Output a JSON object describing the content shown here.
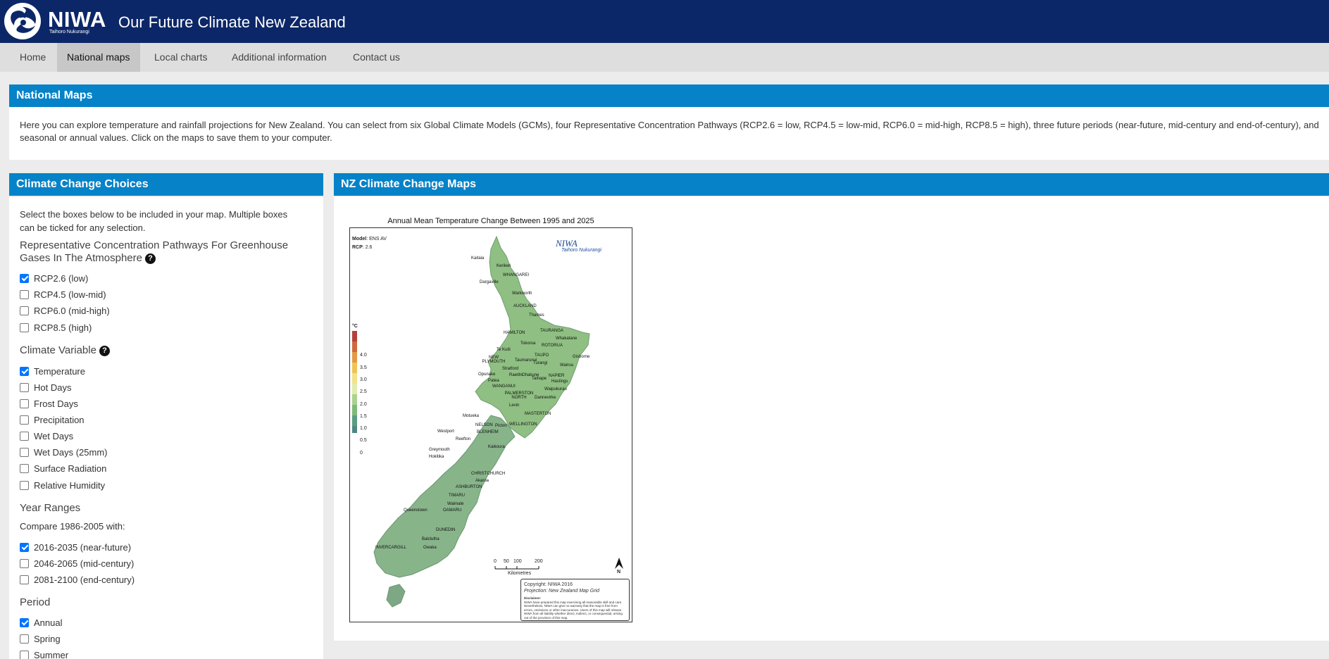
{
  "header": {
    "logo_text": "NIWA",
    "logo_subtext": "Taihoro Nukurangi",
    "site_title": "Our Future Climate New Zealand"
  },
  "nav": {
    "items": [
      "Home",
      "National maps",
      "Local charts",
      "Additional information",
      "Contact us"
    ],
    "active": "National maps"
  },
  "intro": {
    "heading": "National Maps",
    "text": "Here you can explore temperature and rainfall projections for New Zealand. You can select from six Global Climate Models (GCMs), four Representative Concentration Pathways (RCP2.6 = low, RCP4.5 = low-mid, RCP6.0 = mid-high, RCP8.5 = high), three future periods (near-future, mid-century and end-of-century), and seasonal or annual values. Click on the maps to save them to your computer."
  },
  "choices": {
    "heading": "Climate Change Choices",
    "intro": "Select the boxes below to be included in your map. Multiple boxes can be ticked for any selection.",
    "help_glyph": "?",
    "rcp": {
      "title": "Representative Concentration Pathways For Greenhouse Gases In The Atmosphere",
      "options": [
        {
          "label": "RCP2.6 (low)",
          "checked": true
        },
        {
          "label": "RCP4.5 (low-mid)",
          "checked": false
        },
        {
          "label": "RCP6.0 (mid-high)",
          "checked": false
        },
        {
          "label": "RCP8.5 (high)",
          "checked": false
        }
      ]
    },
    "variable": {
      "title": "Climate Variable",
      "options": [
        {
          "label": "Temperature",
          "checked": true
        },
        {
          "label": "Hot Days",
          "checked": false
        },
        {
          "label": "Frost Days",
          "checked": false
        },
        {
          "label": "Precipitation",
          "checked": false
        },
        {
          "label": "Wet Days",
          "checked": false
        },
        {
          "label": "Wet Days (25mm)",
          "checked": false
        },
        {
          "label": "Surface Radiation",
          "checked": false
        },
        {
          "label": "Relative Humidity",
          "checked": false
        }
      ]
    },
    "years": {
      "title": "Year Ranges",
      "compare_text": "Compare 1986-2005 with:",
      "options": [
        {
          "label": "2016-2035 (near-future)",
          "checked": true
        },
        {
          "label": "2046-2065 (mid-century)",
          "checked": false
        },
        {
          "label": "2081-2100 (end-century)",
          "checked": false
        }
      ]
    },
    "period": {
      "title": "Period",
      "options": [
        {
          "label": "Annual",
          "checked": true
        },
        {
          "label": "Spring",
          "checked": false
        },
        {
          "label": "Summer",
          "checked": false
        }
      ]
    }
  },
  "maps": {
    "heading": "NZ Climate Change Maps",
    "map_title": "Annual Mean Temperature Change Between 1995 and 2025",
    "model_label": "Model",
    "model_value": "ENS AV",
    "rcp_label": "RCP",
    "rcp_value": "2.6",
    "legend_unit": "°C",
    "legend_ticks": [
      "4.0",
      "3.5",
      "3.0",
      "2.5",
      "2.0",
      "1.5",
      "1.0",
      "0.5",
      "0"
    ],
    "legend_colors": [
      "#b5403a",
      "#d0683e",
      "#e39a45",
      "#efc455",
      "#f2e38a",
      "#e1ecae",
      "#a9d38e",
      "#7dba7c",
      "#5c9d82",
      "#4e8783"
    ],
    "scale_ticks": [
      "0",
      "50",
      "100",
      "200"
    ],
    "scale_unit": "Kilometres",
    "north": "N",
    "copyright": "Copyright: NIWA 2016",
    "projection": "Projection: New Zealand Map Grid",
    "disclaimer_title": "Disclaimer:",
    "disclaimer": "NIWA have prepared this map exercising all reasonable skill and care. Nevertheless, NIWA can give no warranty that the map is free from errors, omissions or other inaccuracies. Users of this map will release NIWA from all liability whether direct, indirect, or consequential, arising out of the provision of this map.",
    "place_labels": [
      "Kaitaia",
      "Kerikeri",
      "WHANGAREI",
      "Dargaville",
      "Warkworth",
      "AUCKLAND",
      "Thames",
      "TAURANGA",
      "HAMILTON",
      "Whakatane",
      "Tokoroa",
      "ROTORUA",
      "Te Kuiti",
      "TAUPO",
      "NEW PLYMOUTH",
      "Taumarunui",
      "Turangi",
      "Gisborne",
      "Wairoa",
      "Stratford",
      "Opunake",
      "Raetihi",
      "Ohakune",
      "Taihape",
      "NAPIER",
      "Hastings",
      "Patea",
      "WANGANUI",
      "Waipukurau",
      "PALMERSTON NORTH",
      "Dannevirke",
      "Levin",
      "MASTERTON",
      "NELSON",
      "Picton",
      "WELLINGTON",
      "Motueka",
      "Westport",
      "BLENHEIM",
      "Reefton",
      "Kaikoura",
      "Greymouth",
      "Hokitika",
      "CHRISTCHURCH",
      "Akaroa",
      "ASHBURTON",
      "TIMARU",
      "Waimate",
      "Queenstown",
      "OAMARU",
      "DUNEDIN",
      "Balclutha",
      "INVERCARGILL",
      "Owaka"
    ]
  }
}
